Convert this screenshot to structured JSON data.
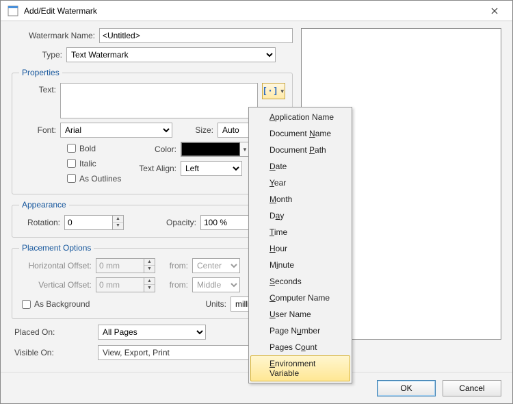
{
  "window": {
    "title": "Add/Edit Watermark"
  },
  "header": {
    "watermark_name_label": "Watermark Name:",
    "watermark_name_value": "<Untitled>",
    "type_label": "Type:",
    "type_value": "Text Watermark"
  },
  "properties": {
    "legend": "Properties",
    "text_label": "Text:",
    "text_value": "",
    "font_label": "Font:",
    "font_value": "Arial",
    "size_label": "Size:",
    "size_value": "Auto",
    "bold_label": "Bold",
    "italic_label": "Italic",
    "as_outlines_label": "As Outlines",
    "color_label": "Color:",
    "color_value": "#000000",
    "text_align_label": "Text Align:",
    "text_align_value": "Left"
  },
  "appearance": {
    "legend": "Appearance",
    "rotation_label": "Rotation:",
    "rotation_value": "0",
    "opacity_label": "Opacity:",
    "opacity_value": "100 %"
  },
  "placement": {
    "legend": "Placement Options",
    "h_offset_label": "Horizontal Offset:",
    "h_offset_value": "0 mm",
    "h_from_label": "from:",
    "h_from_value": "Center",
    "v_offset_label": "Vertical Offset:",
    "v_offset_value": "0 mm",
    "v_from_label": "from:",
    "v_from_value": "Middle",
    "as_background_label": "As Background",
    "units_label": "Units:",
    "units_value": "millimeters"
  },
  "placed_on": {
    "label": "Placed On:",
    "value": "All Pages"
  },
  "visible_on": {
    "label": "Visible On:",
    "value": "View, Export, Print"
  },
  "buttons": {
    "ok": "OK",
    "cancel": "Cancel"
  },
  "macro_menu": {
    "items": [
      "Application Name",
      "Document Name",
      "Document Path",
      "Date",
      "Year",
      "Month",
      "Day",
      "Time",
      "Hour",
      "Minute",
      "Seconds",
      "Computer Name",
      "User Name",
      "Page Number",
      "Pages Count",
      "Environment Variable"
    ],
    "selected_index": 15,
    "accelerators": [
      "A",
      "N",
      "P",
      "D",
      "Y",
      "M",
      "a",
      "T",
      "H",
      "i",
      "S",
      "C",
      "U",
      "u",
      "o",
      "E"
    ]
  }
}
